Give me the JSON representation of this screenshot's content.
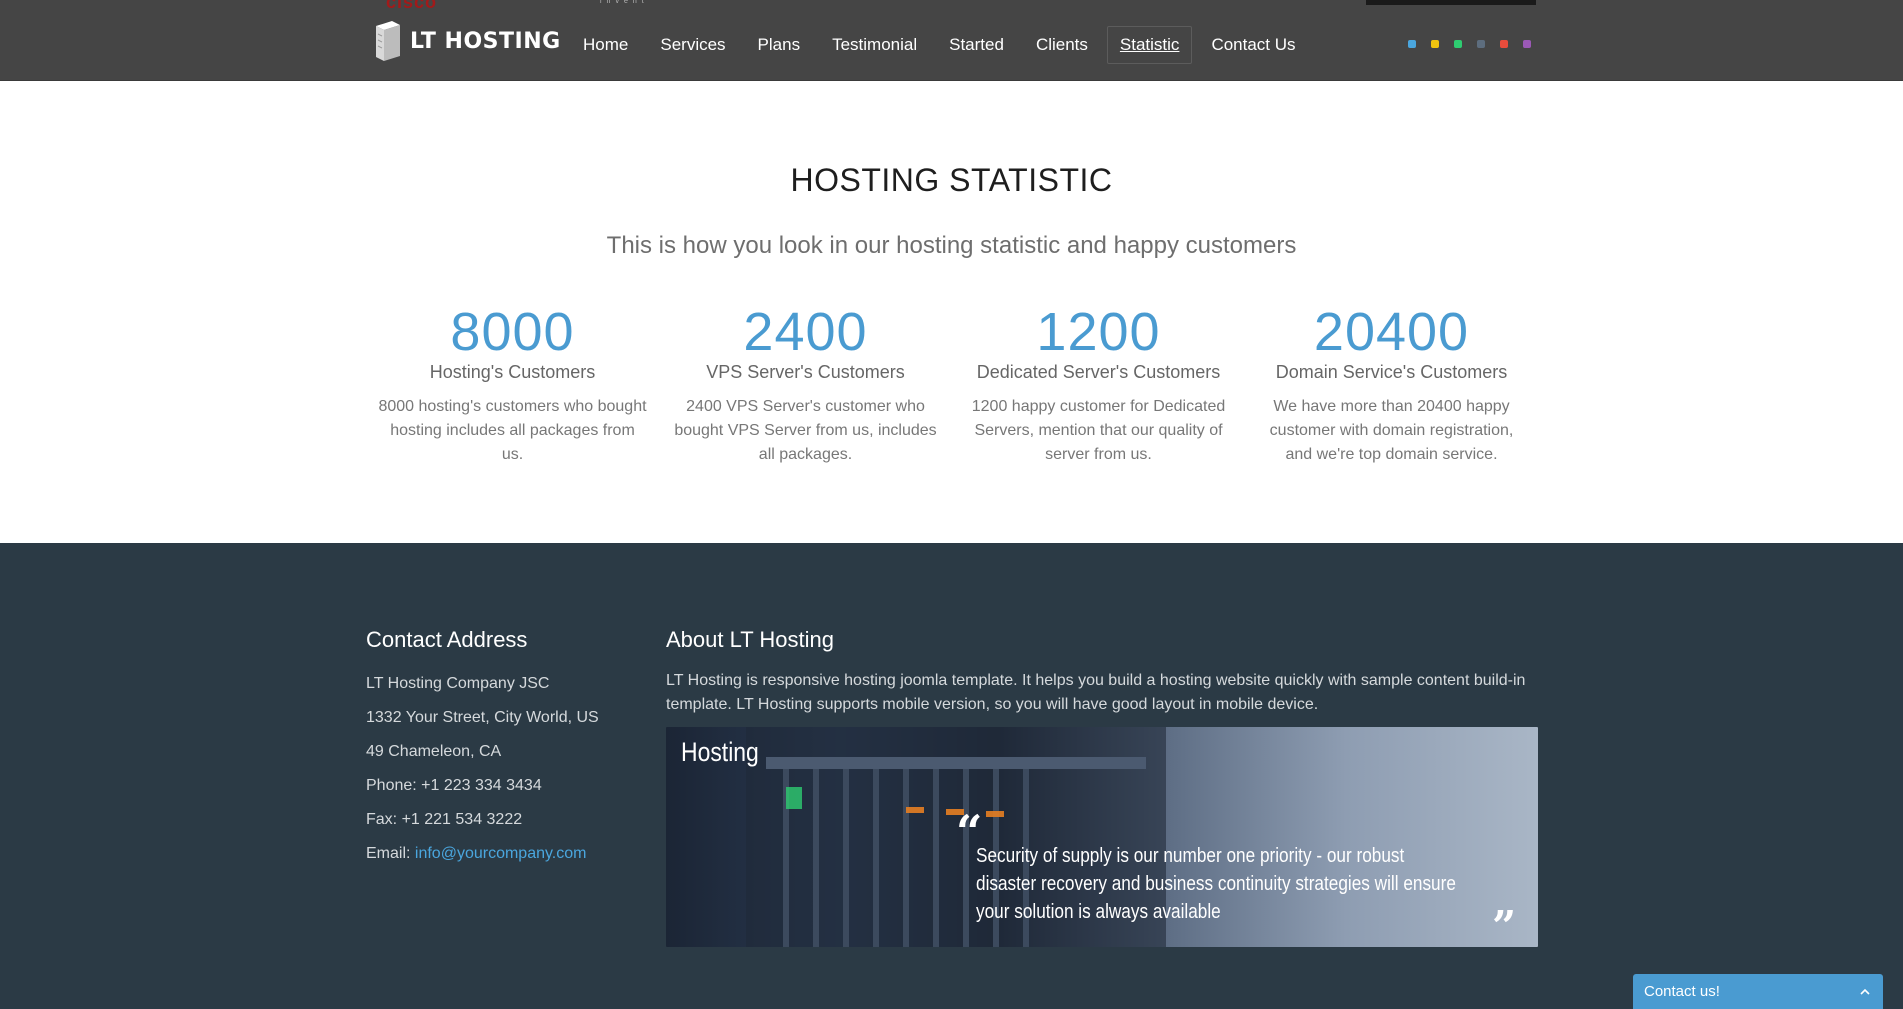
{
  "header": {
    "logo_text": "LT HOSTING",
    "nav": [
      {
        "label": "Home"
      },
      {
        "label": "Services"
      },
      {
        "label": "Plans"
      },
      {
        "label": "Testimonial"
      },
      {
        "label": "Started"
      },
      {
        "label": "Clients"
      },
      {
        "label": "Statistic",
        "active": true
      },
      {
        "label": "Contact Us"
      }
    ],
    "partial_brand_text": "cisco",
    "partial_tagline_text": "invent",
    "color_swatches": [
      "#4aa6de",
      "#f1c40f",
      "#2ecc71",
      "#5d6d7e",
      "#e74c3c",
      "#9b59b6"
    ]
  },
  "statistic": {
    "title": "HOSTING STATISTIC",
    "subtitle": "This is how you look in our hosting statistic and happy customers",
    "items": [
      {
        "number": "8000",
        "label": "Hosting's Customers",
        "desc": "8000 hosting's customers who bought hosting includes all packages from us."
      },
      {
        "number": "2400",
        "label": "VPS Server's Customers",
        "desc": "2400 VPS Server's customer who bought VPS Server from us, includes all packages."
      },
      {
        "number": "1200",
        "label": "Dedicated Server's Customers",
        "desc": "1200 happy customer for Dedicated Servers, mention that our quality of server from us."
      },
      {
        "number": "20400",
        "label": "Domain Service's Customers",
        "desc": "We have more than 20400 happy customer with domain registration, and we're top domain service."
      }
    ],
    "accent_color": "#4a9bd1"
  },
  "footer": {
    "contact": {
      "title": "Contact Address",
      "company": "LT Hosting Company JSC",
      "street": "1332 Your Street, City World, US",
      "city": "49 Chameleon, CA",
      "phone": "Phone: +1 223 334 3434",
      "fax": "Fax: +1 221 534 3222",
      "email_label": "Email:",
      "email": "info@yourcompany.com"
    },
    "about": {
      "title": "About LT Hosting",
      "text": "LT Hosting is responsive hosting joomla template. It helps you build a hosting website quickly with sample content build-in template. LT Hosting supports mobile version, so you will have good layout in mobile device.",
      "banner_title": "Hosting",
      "banner_quote": "Security of supply is our number one priority - our robust disaster recovery and business continuity strategies will ensure your solution is always available"
    },
    "background_color": "#2b3a45"
  },
  "widget": {
    "label": "Contact us!"
  }
}
